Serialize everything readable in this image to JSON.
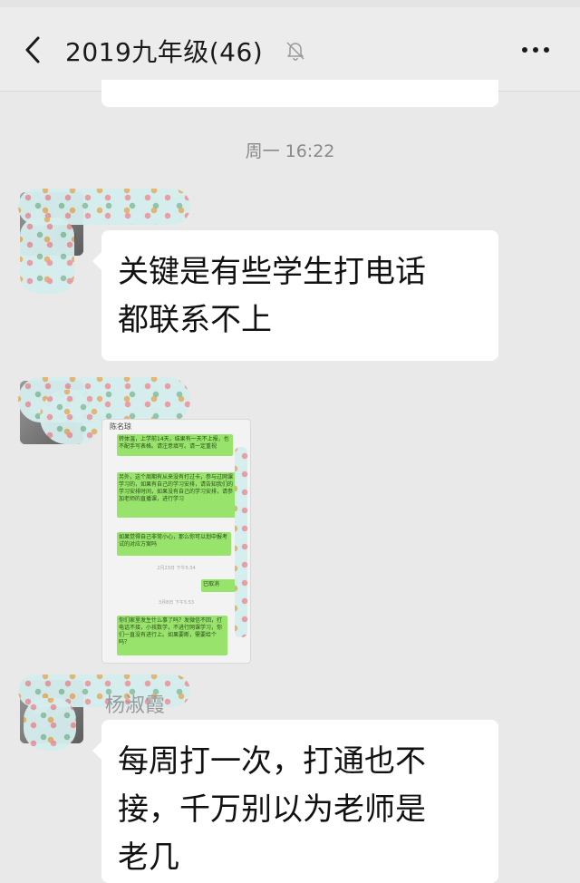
{
  "header": {
    "title": "2019九年级(46)"
  },
  "timestamp": "周一 16:22",
  "messages": [
    {
      "sender": "",
      "text_line1": "关键是有些学生打电话",
      "text_line2": "都联系不上"
    },
    {
      "sender": "",
      "type": "image"
    },
    {
      "sender": "杨淑霞",
      "text_line1": "每周打一次，打通也不",
      "text_line2": "接，千万别以为老师是",
      "text_line3": "老几"
    }
  ],
  "screenshot_image": {
    "title": "陈名琼",
    "bubbles": [
      "转体温，上学前14天，结果有一天不上报，也不配手写表格。请注意填写。请一定重视",
      "另外，这个周期有从来没有打过卡，参与过网课学习的，如果有自己的学习安排，请告知我们的学习安排时间，如果没有自己的学习安排，请参加老师的直播课，进行学习",
      "如果觉得自己非常小心，那么你可以划中报考试的对应方案吗",
      "已取消",
      "你们家里发生什么事了吗？发微信不回，打电话不接，小孩数学，不进行网课学习，你们一直没有进行上。如果要断，需要给个吗？"
    ],
    "times": [
      "2月23日 下午5:34",
      "3月8日 下午5:53"
    ]
  }
}
